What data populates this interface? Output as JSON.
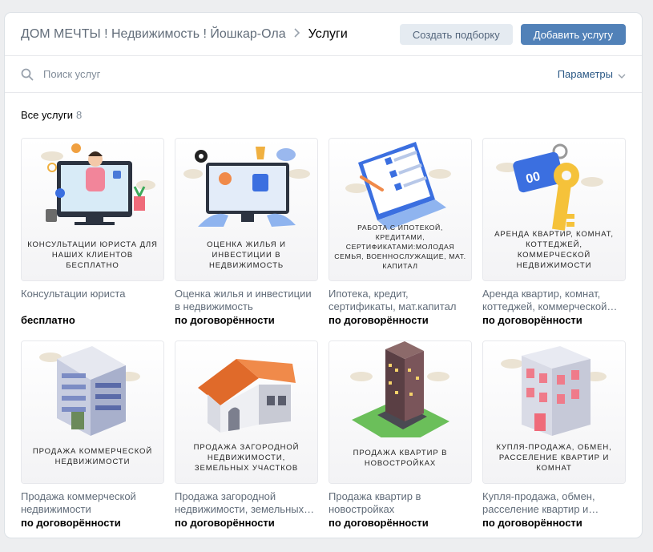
{
  "header": {
    "group_name": "ДОМ МЕЧТЫ ! Недвижимость ! Йошкар-Ола",
    "current": "Услуги",
    "create_selection": "Создать подборку",
    "add_service": "Добавить услугу"
  },
  "search": {
    "placeholder": "Поиск услуг",
    "params_label": "Параметры"
  },
  "section": {
    "title": "Все услуги",
    "count": "8"
  },
  "services": [
    {
      "caption": "КОНСУЛЬТАЦИИ ЮРИСТА ДЛЯ НАШИХ КЛИЕНТОВ БЕСПЛАТНО",
      "title": "Консультации юриста",
      "price": "бесплатно",
      "icon": "lawyer-consultation-icon"
    },
    {
      "caption": "ОЦЕНКА ЖИЛЬЯ И ИНВЕСТИЦИИ В НЕДВИЖИМОСТЬ",
      "title": "Оценка жилья и инвестиции в недвижимость",
      "price": "по договорённости",
      "icon": "property-valuation-icon"
    },
    {
      "caption": "РАБОТА С ИПОТЕКОЙ, КРЕДИТАМИ, СЕРТИФИКАТАМИ:МОЛОДАЯ СЕМЬЯ, ВОЕННОСЛУЖАЩИЕ, МАТ. КАПИТАЛ",
      "title": "Ипотека, кредит, сертификаты, мат.капитал",
      "price": "по договорённости",
      "icon": "mortgage-checklist-icon"
    },
    {
      "caption": "АРЕНДА КВАРТИР, КОМНАТ, КОТТЕДЖЕЙ, КОММЕРЧЕСКОЙ НЕДВИЖИМОСТИ",
      "title": "Аренда квартир, комнат, коттеджей, коммерческой…",
      "price": "по договорённости",
      "icon": "key-icon"
    },
    {
      "caption": "ПРОДАЖА КОММЕРЧЕСКОЙ НЕДВИЖИМОСТИ",
      "title": "Продажа коммерческой недвижимости",
      "price": "по договорённости",
      "icon": "commercial-building-icon"
    },
    {
      "caption": "ПРОДАЖА ЗАГОРОДНОЙ НЕДВИЖИМОСТИ, ЗЕМЕЛЬНЫХ УЧАСТКОВ",
      "title": "Продажа загородной недвижимости, земельных…",
      "price": "по договорённости",
      "icon": "house-icon"
    },
    {
      "caption": "ПРОДАЖА КВАРТИР В НОВОСТРОЙКАХ",
      "title": "Продажа квартир в новостройках",
      "price": "по договорённости",
      "icon": "highrise-icon"
    },
    {
      "caption": "КУПЛЯ-ПРОДАЖА, ОБМЕН, РАССЕЛЕНИЕ КВАРТИР И КОМНАТ",
      "title": "Купля-продажа, обмен, расселение квартир и…",
      "price": "по договорённости",
      "icon": "apartment-building-icon"
    }
  ]
}
